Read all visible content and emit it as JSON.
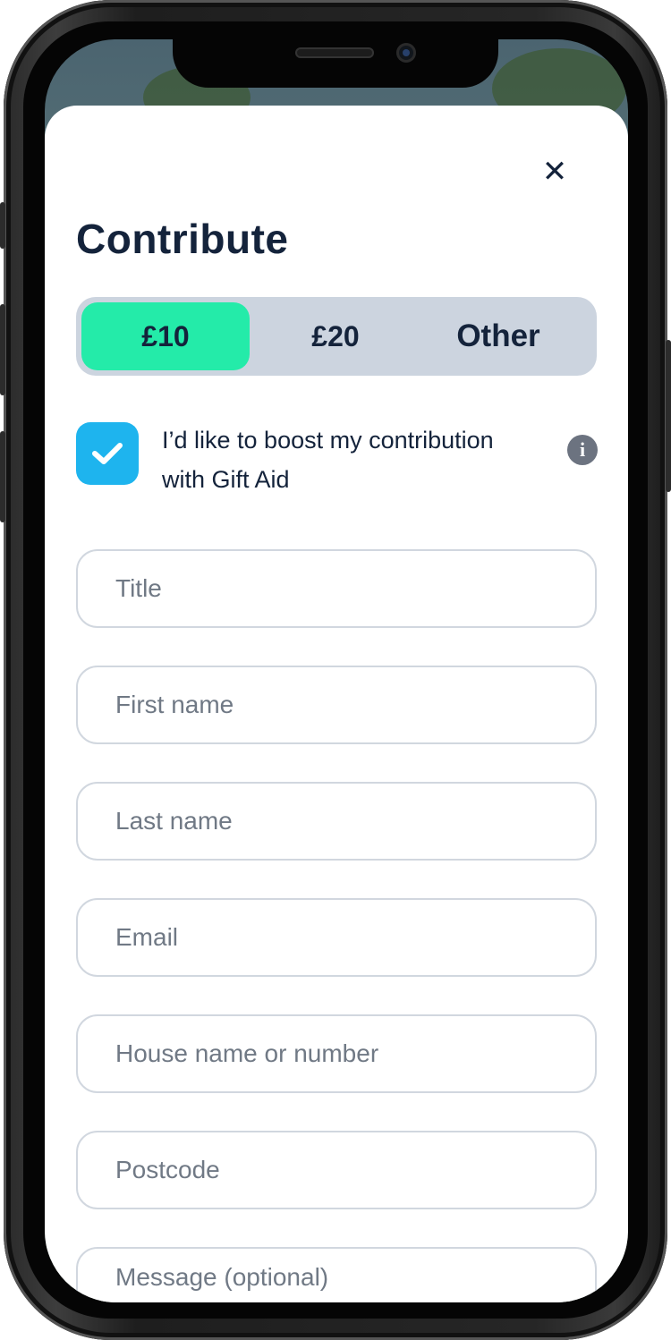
{
  "modal": {
    "title": "Contribute",
    "close_icon": "close-icon"
  },
  "amount_selector": {
    "options": [
      {
        "label": "£10",
        "selected": true
      },
      {
        "label": "£20",
        "selected": false
      },
      {
        "label": "Other",
        "selected": false
      }
    ]
  },
  "gift_aid": {
    "checked": true,
    "label": "I’d like to boost my contribution with Gift Aid",
    "info_icon": "info-icon"
  },
  "form": {
    "fields": [
      {
        "placeholder": "Title",
        "value": ""
      },
      {
        "placeholder": "First name",
        "value": ""
      },
      {
        "placeholder": "Last name",
        "value": ""
      },
      {
        "placeholder": "Email",
        "value": ""
      },
      {
        "placeholder": "House name or number",
        "value": ""
      },
      {
        "placeholder": "Postcode",
        "value": ""
      },
      {
        "placeholder": "Message (optional)",
        "value": ""
      }
    ]
  },
  "colors": {
    "primary_text": "#14233b",
    "accent_selected": "#24eba9",
    "segment_bg": "#ccd4df",
    "checkbox": "#1eb4ee",
    "field_border": "#d1d7df",
    "placeholder": "#707985"
  }
}
